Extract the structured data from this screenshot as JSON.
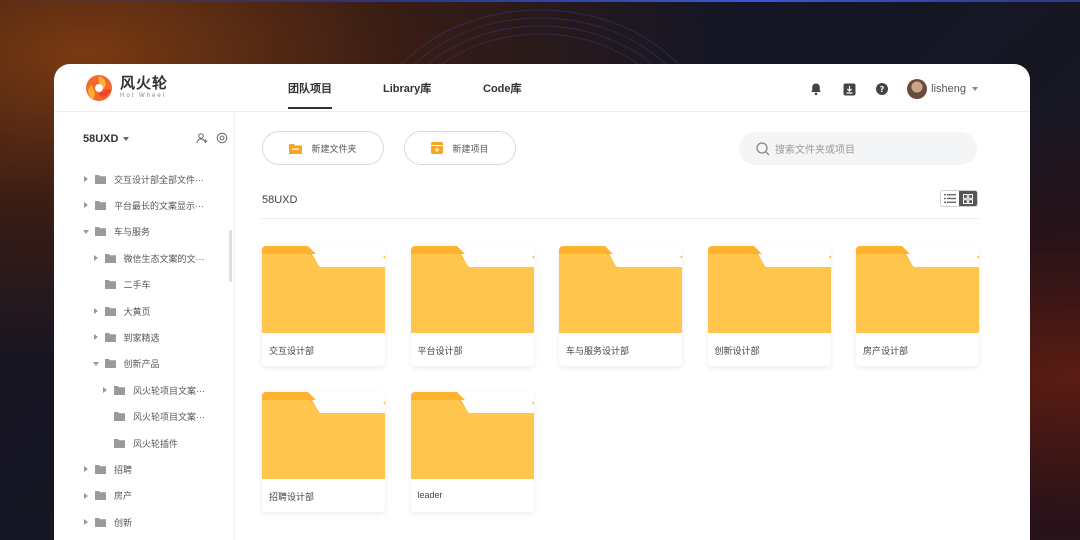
{
  "app": {
    "logo_cn": "风火轮",
    "logo_en": "Hot Wheel",
    "tabs": [
      {
        "label": "团队项目",
        "active": true
      },
      {
        "label": "Library库",
        "active": false
      },
      {
        "label": "Code库",
        "active": false
      }
    ],
    "icons": [
      "bell-icon",
      "download-icon",
      "help-icon"
    ],
    "user": {
      "name": "lisheng"
    }
  },
  "sidebar": {
    "team": "58UXD",
    "tree": [
      {
        "label": "交互设计部全部文件···",
        "level": 0,
        "arrow": "right"
      },
      {
        "label": "平台最长的文案显示···",
        "level": 0,
        "arrow": "right"
      },
      {
        "label": "车与服务",
        "level": 0,
        "arrow": "down"
      },
      {
        "label": "微信生态文案的文···",
        "level": 1,
        "arrow": "right"
      },
      {
        "label": "二手车",
        "level": 1,
        "arrow": "none"
      },
      {
        "label": "大黄页",
        "level": 1,
        "arrow": "right"
      },
      {
        "label": "到家精选",
        "level": 1,
        "arrow": "right"
      },
      {
        "label": "创新产品",
        "level": 1,
        "arrow": "down"
      },
      {
        "label": "风火轮项目文案···",
        "level": 2,
        "arrow": "right"
      },
      {
        "label": "风火轮项目文案···",
        "level": 2,
        "arrow": "none"
      },
      {
        "label": "风火轮插件",
        "level": 2,
        "arrow": "none"
      },
      {
        "label": "招聘",
        "level": 0,
        "arrow": "right"
      },
      {
        "label": "房产",
        "level": 0,
        "arrow": "right"
      },
      {
        "label": "创新",
        "level": 0,
        "arrow": "right"
      }
    ]
  },
  "main": {
    "new_folder_label": "新建文件夹",
    "new_project_label": "新建项目",
    "search_placeholder": "搜索文件夹或项目",
    "breadcrumb": "58UXD",
    "folders": [
      "交互设计部",
      "平台设计部",
      "车与服务设计部",
      "创新设计部",
      "房产设计部",
      "招聘设计部",
      "leader"
    ]
  },
  "colors": {
    "folder": "#FFC54D",
    "folder_back": "#FFB22E",
    "accent": "#F5A623"
  }
}
